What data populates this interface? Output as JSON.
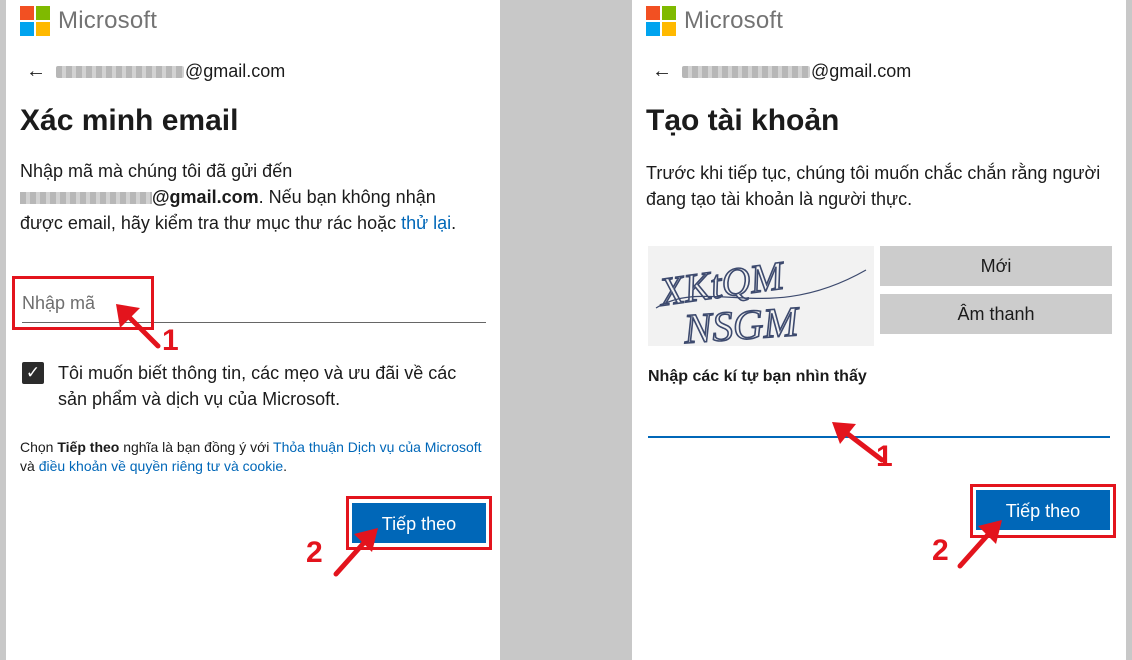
{
  "brand": {
    "name": "Microsoft",
    "colors": {
      "red": "#f25022",
      "green": "#7fba00",
      "blue": "#00a4ef",
      "yellow": "#ffb900"
    }
  },
  "accent_color": "#0067b8",
  "annotation_color": "#e3141d",
  "left": {
    "back_icon": "back-arrow-icon",
    "email_domain": "@gmail.com",
    "title": "Xác minh email",
    "intro_line1": "Nhập mã mà chúng tôi đã gửi đến",
    "intro_email_domain": "@gmail.com",
    "intro_line2": ". Nếu bạn không nhận được email, hãy kiểm tra thư mục thư rác hoặc ",
    "retry_link": "thử lại",
    "intro_end": ".",
    "code_placeholder": "Nhập mã",
    "checkbox_label": "Tôi muốn biết thông tin, các mẹo và ưu đãi về các sản phẩm và dịch vụ của Microsoft.",
    "checkbox_checked": true,
    "terms_prefix": "Chọn ",
    "terms_bold": "Tiếp theo",
    "terms_mid": " nghĩa là bạn đồng ý với ",
    "terms_link1": "Thỏa thuận Dịch vụ của Microsoft",
    "terms_and": " và ",
    "terms_link2": "điều khoản về quyền riêng tư và cookie",
    "terms_end": ".",
    "next_button": "Tiếp theo",
    "callout_1": "1",
    "callout_2": "2"
  },
  "right": {
    "back_icon": "back-arrow-icon",
    "email_domain": "@gmail.com",
    "title": "Tạo tài khoản",
    "intro": "Trước khi tiếp tục, chúng tôi muốn chắc chắn rằng người đang tạo tài khoản là người thực.",
    "captcha_line1": "XKtQM",
    "captcha_line2": "NSGM",
    "new_button": "Mới",
    "audio_button": "Âm thanh",
    "captcha_label": "Nhập các kí tự bạn nhìn thấy",
    "next_button": "Tiếp theo",
    "callout_1": "1",
    "callout_2": "2"
  }
}
